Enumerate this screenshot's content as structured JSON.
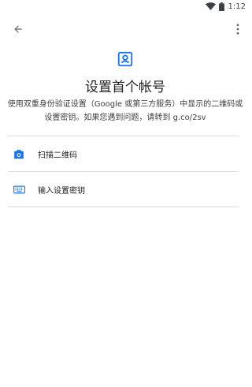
{
  "status_bar": {
    "time": "1:12"
  },
  "header": {
    "title": "设置首个帐号",
    "description_line1": "使用双重身份验证设置（Google 或第三方服务）中显示的二维码或",
    "description_line2": "设置密钥。如果您遇到问题，请转到 g.co/2sv"
  },
  "options": [
    {
      "label": "扫描二维码",
      "icon": "camera-icon"
    },
    {
      "label": "输入设置密钥",
      "icon": "keyboard-icon"
    }
  ],
  "colors": {
    "accent": "#1a73e8",
    "divider": "#dadce0"
  }
}
